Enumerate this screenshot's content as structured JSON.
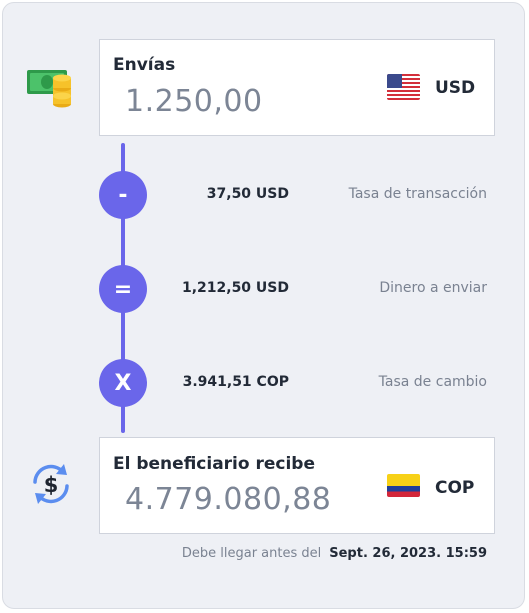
{
  "send": {
    "label": "Envías",
    "amount": "1.250,00",
    "currency": "USD",
    "flag_icon": "us-flag-icon"
  },
  "steps": [
    {
      "symbol": "-",
      "value": "37,50 USD",
      "label": "Tasa de transacción"
    },
    {
      "symbol": "=",
      "value": "1,212,50 USD",
      "label": "Dinero a enviar"
    },
    {
      "symbol": "X",
      "value": "3.941,51 COP",
      "label": "Tasa de cambio"
    }
  ],
  "receive": {
    "label": "El beneficiario recibe",
    "amount": "4.779.080,88",
    "currency": "COP",
    "flag_icon": "colombia-flag-icon"
  },
  "footer": {
    "prefix": "Debe llegar antes del",
    "date": "Sept. 26, 2023. 15:59"
  },
  "colors": {
    "accent": "#6a66ea",
    "panel_bg": "#eef0f5",
    "text_dark": "#222a37",
    "text_muted": "#7a8291"
  }
}
